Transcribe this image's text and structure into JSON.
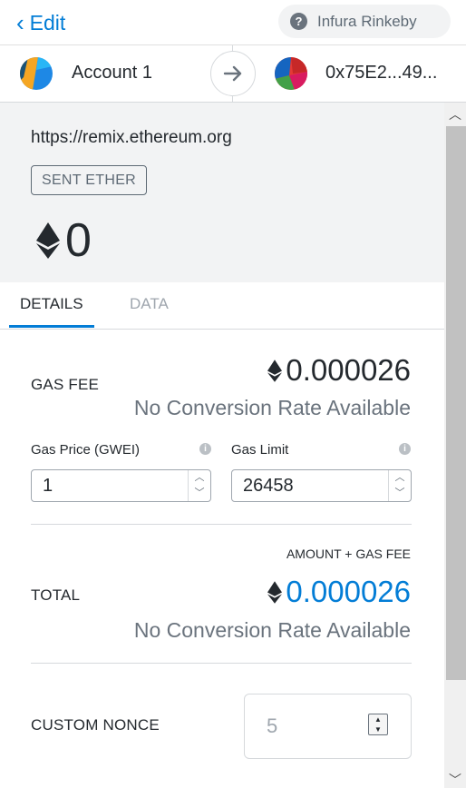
{
  "header": {
    "back_label": "Edit",
    "network_label": "Infura Rinkeby"
  },
  "accounts": {
    "from_name": "Account 1",
    "to_address": "0x75E2...49..."
  },
  "summary": {
    "origin": "https://remix.ethereum.org",
    "action": "SENT ETHER",
    "amount": "0"
  },
  "tabs": [
    {
      "label": "DETAILS",
      "active": true
    },
    {
      "label": "DATA",
      "active": false
    }
  ],
  "details": {
    "gas_fee_label": "GAS FEE",
    "gas_fee_value": "0.000026",
    "gas_fee_conversion": "No Conversion Rate Available",
    "gas_price_label": "Gas Price (GWEI)",
    "gas_price_value": "1",
    "gas_limit_label": "Gas Limit",
    "gas_limit_value": "26458",
    "total_heading": "AMOUNT + GAS FEE",
    "total_label": "TOTAL",
    "total_value": "0.000026",
    "total_conversion": "No Conversion Rate Available",
    "nonce_label": "CUSTOM NONCE",
    "nonce_value": "5"
  },
  "colors": {
    "accent": "#037dd6",
    "text": "#24292e",
    "muted": "#6a737d",
    "summary_bg": "#f2f3f4"
  },
  "icons": [
    "chevron-left-icon",
    "question-icon",
    "arrow-right-icon",
    "ethereum-icon",
    "info-icon",
    "scroll-up-icon",
    "scroll-down-icon"
  ]
}
